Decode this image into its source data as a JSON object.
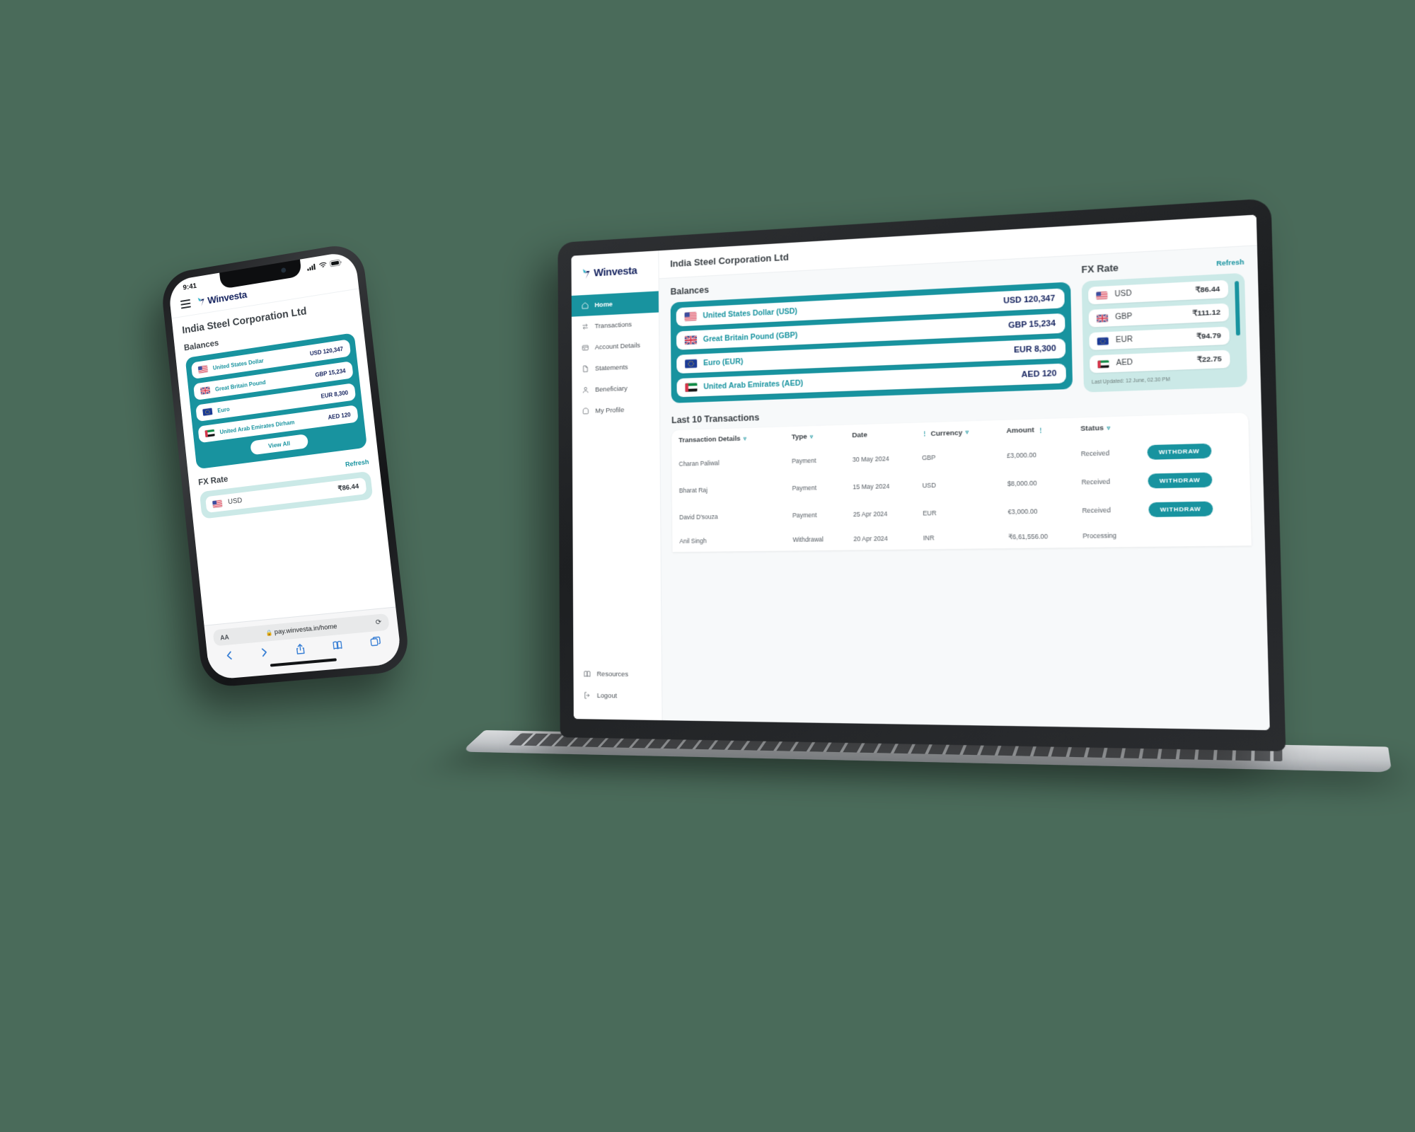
{
  "brand": {
    "name": "Winvesta",
    "accent": "#18939f",
    "navy": "#14225e",
    "fx_bg": "#cbe9e7",
    "processing": "#f08a6a"
  },
  "desktop": {
    "sidebar": {
      "items": [
        {
          "label": "Home",
          "icon": "home-icon",
          "active": true
        },
        {
          "label": "Transactions",
          "icon": "transfer-icon",
          "active": false
        },
        {
          "label": "Account Details",
          "icon": "account-details-icon",
          "active": false
        },
        {
          "label": "Statements",
          "icon": "document-icon",
          "active": false
        },
        {
          "label": "Beneficiary",
          "icon": "user-icon",
          "active": false
        },
        {
          "label": "My Profile",
          "icon": "profile-icon",
          "active": false
        }
      ],
      "bottom_items": [
        {
          "label": "Resources",
          "icon": "book-icon"
        },
        {
          "label": "Logout",
          "icon": "logout-icon"
        }
      ]
    },
    "company_title": "India Steel Corporation Ltd",
    "balances": {
      "title": "Balances",
      "rows": [
        {
          "flag": "us-flag-icon",
          "name": "United States Dollar (USD)",
          "amount": "USD  120,347"
        },
        {
          "flag": "gb-flag-icon",
          "name": "Great Britain Pound (GBP)",
          "amount": "GBP 15,234"
        },
        {
          "flag": "eu-flag-icon",
          "name": "Euro (EUR)",
          "amount": "EUR 8,300"
        },
        {
          "flag": "ae-flag-icon",
          "name": "United Arab Emirates (AED)",
          "amount": "AED 120"
        }
      ]
    },
    "fx": {
      "title": "FX Rate",
      "refresh_label": "Refresh",
      "rows": [
        {
          "flag": "us-flag-icon",
          "code": "USD",
          "rate": "₹86.44"
        },
        {
          "flag": "gb-flag-icon",
          "code": "GBP",
          "rate": "₹111.12"
        },
        {
          "flag": "eu-flag-icon",
          "code": "EUR",
          "rate": "₹94.79"
        },
        {
          "flag": "ae-flag-icon",
          "code": "AED",
          "rate": "₹22.75"
        }
      ],
      "last_updated": "Last Updated: 12 June, 02.30 PM"
    },
    "transactions": {
      "title": "Last 10 Transactions",
      "columns": [
        {
          "label": "Transaction Details",
          "control": "filter"
        },
        {
          "label": "Type",
          "control": "filter"
        },
        {
          "label": "Date",
          "control": "none"
        },
        {
          "label": "Currency",
          "control": "sort-filter"
        },
        {
          "label": "Amount",
          "control": "sort"
        },
        {
          "label": "Status",
          "control": "filter"
        },
        {
          "label": "",
          "control": "none"
        }
      ],
      "rows": [
        {
          "details": "Charan Paliwal",
          "type": "Payment",
          "date": "30 May 2024",
          "currency": "GBP",
          "amount": "£3,000.00",
          "status": "Received",
          "action": "WITHDRAW"
        },
        {
          "details": "Bharat Raj",
          "type": "Payment",
          "date": "15 May 2024",
          "currency": "USD",
          "amount": "$8,000.00",
          "status": "Received",
          "action": "WITHDRAW"
        },
        {
          "details": "David D'souza",
          "type": "Payment",
          "date": "25 Apr 2024",
          "currency": "EUR",
          "amount": "€3,000.00",
          "status": "Received",
          "action": "WITHDRAW"
        },
        {
          "details": "Anil Singh",
          "type": "Withdrawal",
          "date": "20 Apr 2024",
          "currency": "INR",
          "amount": "₹6,61,556.00",
          "status": "Processing",
          "action": ""
        }
      ]
    }
  },
  "phone": {
    "status_time": "9:41",
    "company_title": "India Steel Corporation Ltd",
    "balances": {
      "title": "Balances",
      "rows": [
        {
          "flag": "us-flag-icon",
          "name": "United States Dollar",
          "amount": "USD 120,347"
        },
        {
          "flag": "gb-flag-icon",
          "name": "Great Britain Pound",
          "amount": "GBP 15,234"
        },
        {
          "flag": "eu-flag-icon",
          "name": "Euro",
          "amount": "EUR 8,300"
        },
        {
          "flag": "ae-flag-icon",
          "name": "United Arab Emirates Dirham",
          "amount": "AED 120"
        }
      ],
      "view_all_label": "View All"
    },
    "fx": {
      "title": "FX Rate",
      "refresh_label": "Refresh",
      "rows": [
        {
          "flag": "us-flag-icon",
          "code": "USD",
          "rate": "₹86.44"
        }
      ]
    },
    "browser": {
      "aa_label": "AA",
      "url": "pay.winvesta.in/home",
      "lock_icon": "lock-icon",
      "reload_icon": "reload-icon",
      "nav": [
        "back-icon",
        "forward-icon",
        "share-icon",
        "bookmarks-icon",
        "tabs-icon"
      ]
    }
  }
}
